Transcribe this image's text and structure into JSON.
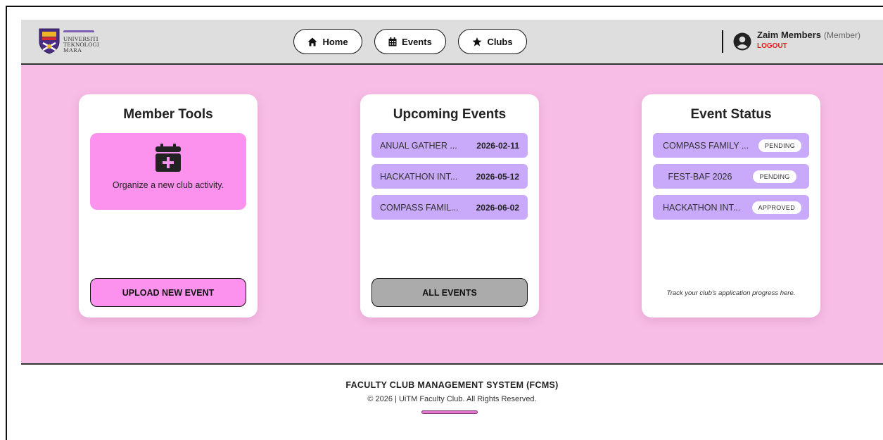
{
  "header": {
    "logo": {
      "line1": "UNIVERSITI",
      "line2": "TEKNOLOGI",
      "line3": "MARA"
    },
    "nav": [
      {
        "label": "Home",
        "icon": "home-icon"
      },
      {
        "label": "Events",
        "icon": "calendar-icon"
      },
      {
        "label": "Clubs",
        "icon": "star-icon"
      }
    ],
    "user": {
      "name": "Zaim Members",
      "role": "(Member)",
      "logout_label": "LOGOUT",
      "icon": "user-circle-icon"
    }
  },
  "main": {
    "member_tools": {
      "title": "Member Tools",
      "tool_text": "Organize a new club activity.",
      "tool_icon": "calendar-plus-icon",
      "button_label": "UPLOAD NEW EVENT"
    },
    "upcoming_events": {
      "title": "Upcoming Events",
      "items": [
        {
          "name": "ANUAL GATHER ...",
          "date": "2026-02-11"
        },
        {
          "name": "HACKATHON INT...",
          "date": "2026-05-12"
        },
        {
          "name": "COMPASS FAMIL...",
          "date": "2026-06-02"
        }
      ],
      "button_label": "ALL EVENTS"
    },
    "event_status": {
      "title": "Event Status",
      "items": [
        {
          "name": "COMPASS FAMILY ...",
          "status": "PENDING"
        },
        {
          "name": "FEST-BAF 2026",
          "status": "PENDING"
        },
        {
          "name": "HACKATHON INT...",
          "status": "APPROVED"
        }
      ],
      "note": "Track your club's application progress here."
    }
  },
  "footer": {
    "title": "FACULTY CLUB MANAGEMENT SYSTEM (FCMS)",
    "copyright": "© 2026 | UiTM Faculty Club. All Rights Reserved."
  },
  "colors": {
    "header_bg": "#dedede",
    "main_bg": "#f7bde6",
    "pink_accent": "#fc92ee",
    "lavender": "#c8a9fa",
    "gray_button": "#ababab",
    "logout_red": "#e5201c"
  }
}
